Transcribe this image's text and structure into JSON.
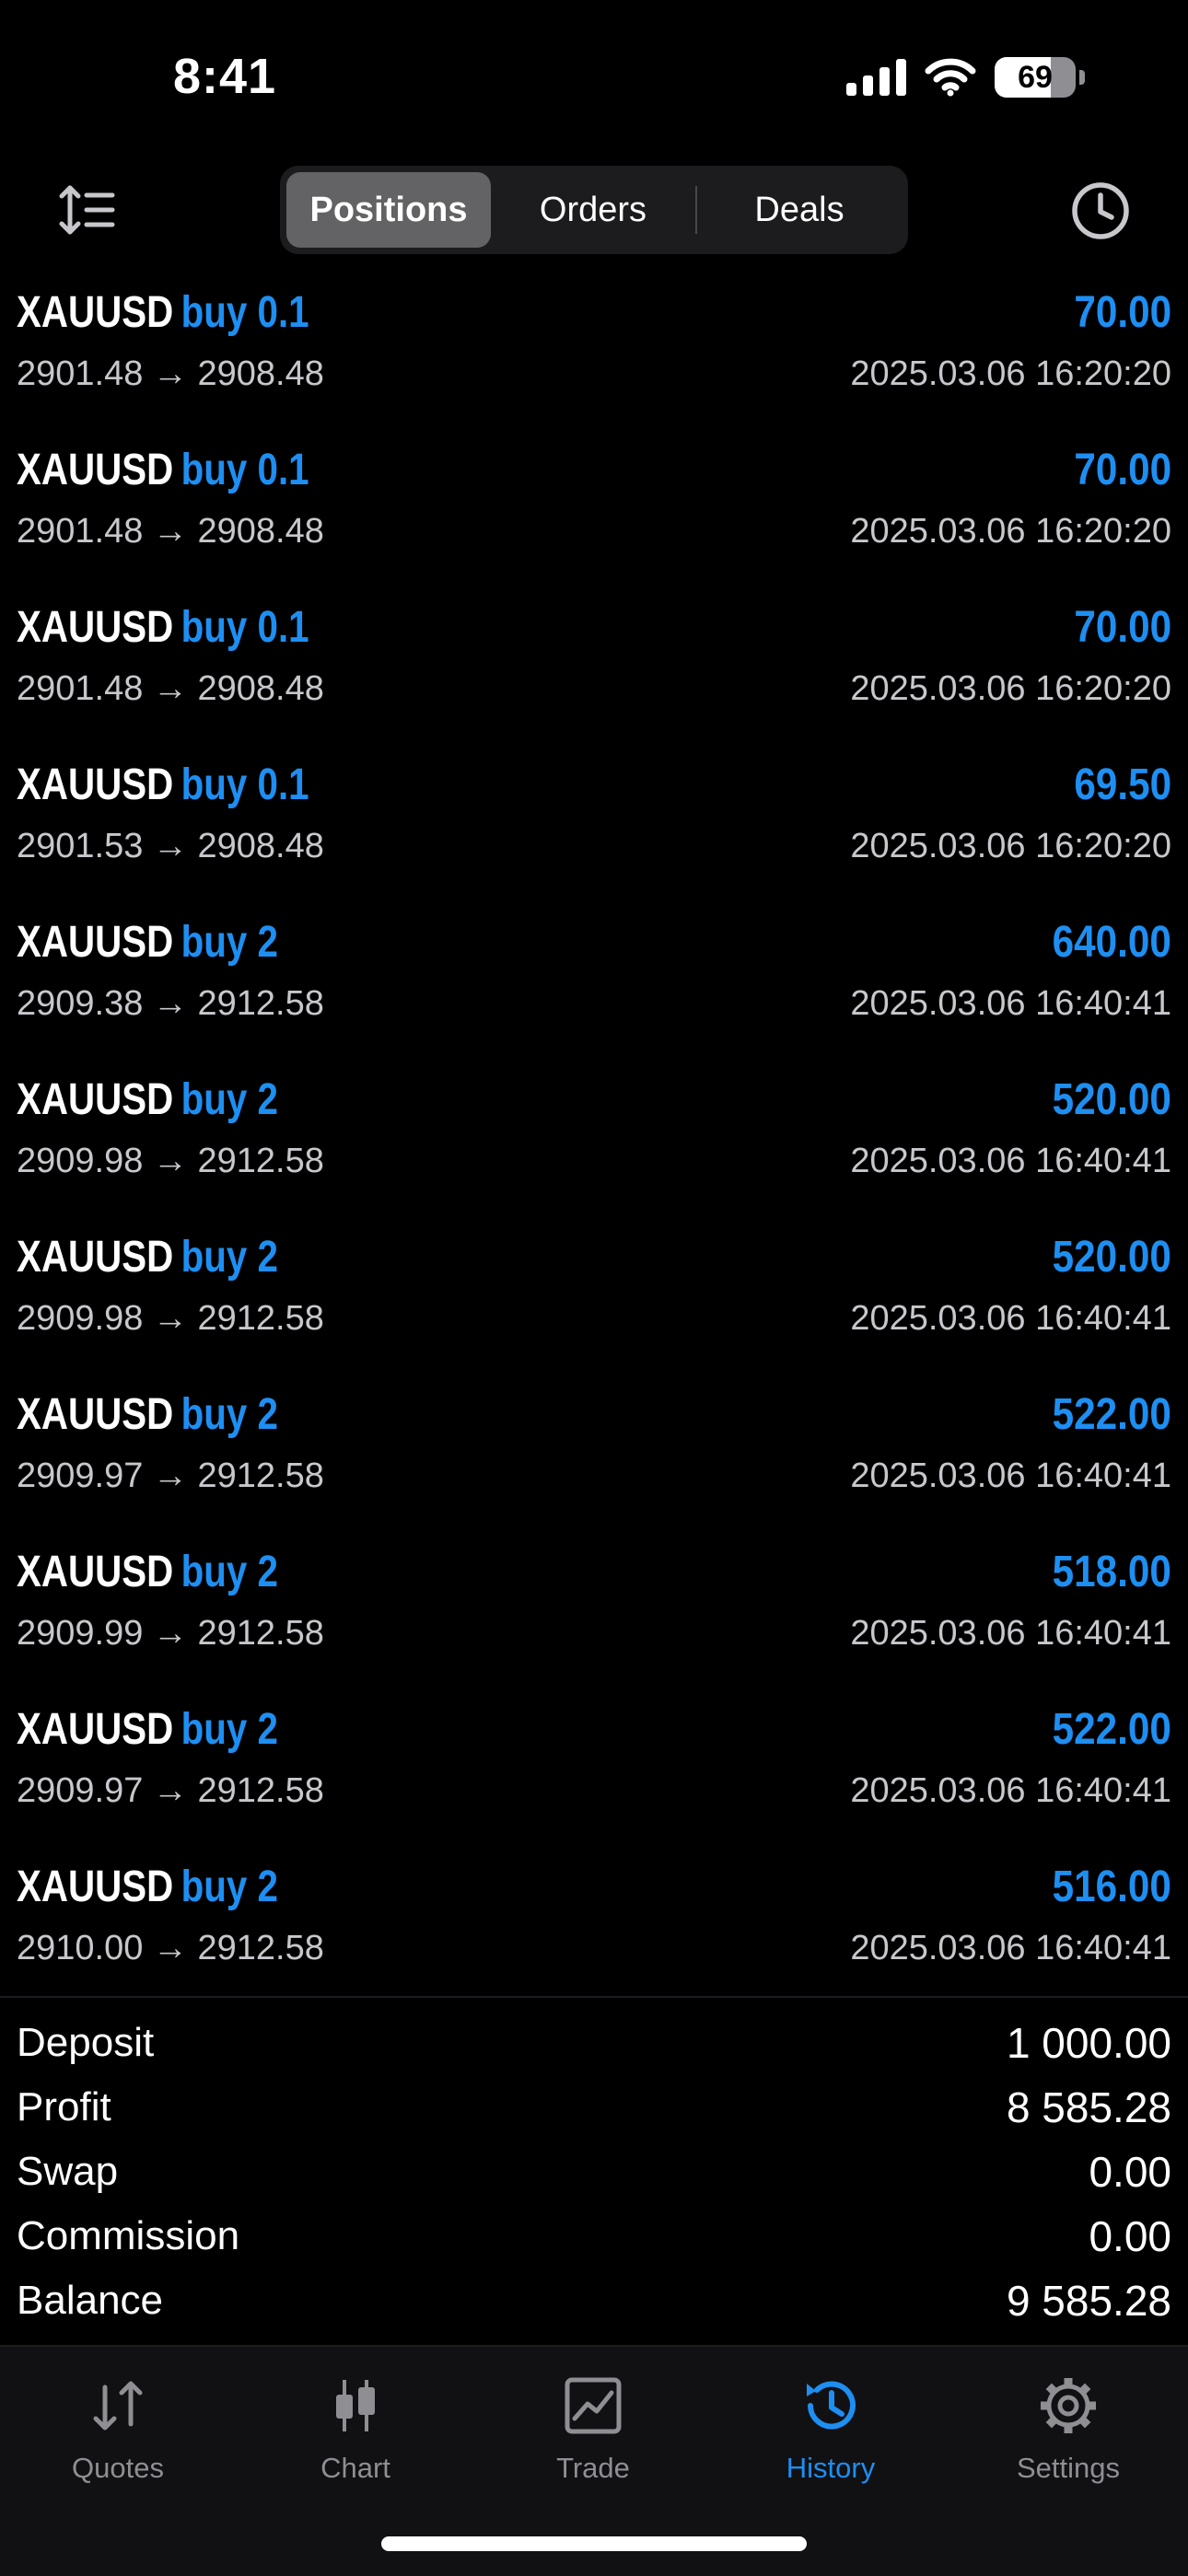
{
  "status_bar": {
    "time": "8:41",
    "battery_percent": "69",
    "battery_level": 0.69
  },
  "toolbar": {
    "tabs": [
      {
        "label": "Positions",
        "active": true
      },
      {
        "label": "Orders",
        "active": false
      },
      {
        "label": "Deals",
        "active": false
      }
    ]
  },
  "deals": [
    {
      "symbol": "XAUUSD",
      "side": "buy 0.1",
      "profit": "70.00",
      "prices": "2901.48 → 2908.48",
      "datetime": "2025.03.06 16:20:20"
    },
    {
      "symbol": "XAUUSD",
      "side": "buy 0.1",
      "profit": "70.00",
      "prices": "2901.48 → 2908.48",
      "datetime": "2025.03.06 16:20:20"
    },
    {
      "symbol": "XAUUSD",
      "side": "buy 0.1",
      "profit": "70.00",
      "prices": "2901.48 → 2908.48",
      "datetime": "2025.03.06 16:20:20"
    },
    {
      "symbol": "XAUUSD",
      "side": "buy 0.1",
      "profit": "69.50",
      "prices": "2901.53 → 2908.48",
      "datetime": "2025.03.06 16:20:20"
    },
    {
      "symbol": "XAUUSD",
      "side": "buy 2",
      "profit": "640.00",
      "prices": "2909.38 → 2912.58",
      "datetime": "2025.03.06 16:40:41"
    },
    {
      "symbol": "XAUUSD",
      "side": "buy 2",
      "profit": "520.00",
      "prices": "2909.98 → 2912.58",
      "datetime": "2025.03.06 16:40:41"
    },
    {
      "symbol": "XAUUSD",
      "side": "buy 2",
      "profit": "520.00",
      "prices": "2909.98 → 2912.58",
      "datetime": "2025.03.06 16:40:41"
    },
    {
      "symbol": "XAUUSD",
      "side": "buy 2",
      "profit": "522.00",
      "prices": "2909.97 → 2912.58",
      "datetime": "2025.03.06 16:40:41"
    },
    {
      "symbol": "XAUUSD",
      "side": "buy 2",
      "profit": "518.00",
      "prices": "2909.99 → 2912.58",
      "datetime": "2025.03.06 16:40:41"
    },
    {
      "symbol": "XAUUSD",
      "side": "buy 2",
      "profit": "522.00",
      "prices": "2909.97 → 2912.58",
      "datetime": "2025.03.06 16:40:41"
    },
    {
      "symbol": "XAUUSD",
      "side": "buy 2",
      "profit": "516.00",
      "prices": "2910.00 → 2912.58",
      "datetime": "2025.03.06 16:40:41"
    }
  ],
  "summary": {
    "deposit_label": "Deposit",
    "deposit": "1 000.00",
    "profit_label": "Profit",
    "profit": "8 585.28",
    "swap_label": "Swap",
    "swap": "0.00",
    "commission_label": "Commission",
    "commission": "0.00",
    "balance_label": "Balance",
    "balance": "9 585.28"
  },
  "tabbar": {
    "items": [
      {
        "label": "Quotes",
        "icon": "quotes-icon"
      },
      {
        "label": "Chart",
        "icon": "chart-icon"
      },
      {
        "label": "Trade",
        "icon": "trade-icon"
      },
      {
        "label": "History",
        "icon": "history-icon",
        "active": true
      },
      {
        "label": "Settings",
        "icon": "gear-icon"
      }
    ]
  },
  "colors": {
    "accent": "#1e8ff2",
    "background": "#000000",
    "secondary_text": "#c7c7cc",
    "inactive_tab": "#8e8e93"
  }
}
